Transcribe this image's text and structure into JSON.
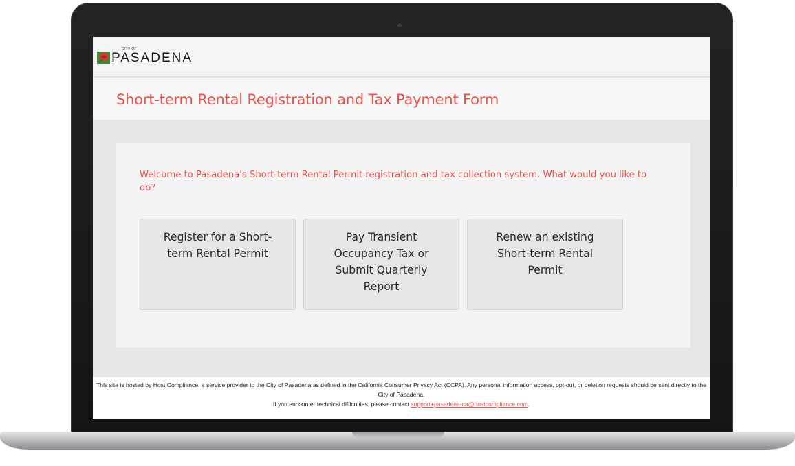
{
  "header": {
    "logo_small": "CITY OF",
    "logo_text": "PASADENA"
  },
  "page": {
    "title": "Short-term Rental Registration and Tax Payment Form",
    "welcome": "Welcome to Pasadena's Short-term Rental Permit registration and tax collection system. What would you like to do?"
  },
  "options": [
    {
      "label": "Register for a Short-term Rental Permit"
    },
    {
      "label": "Pay Transient Occupancy Tax or Submit Quarterly Report"
    },
    {
      "label": "Renew an existing Short-term Rental Permit"
    }
  ],
  "footer": {
    "line1": "This site is hosted by Host Compliance, a service provider to the City of Pasadena as defined in the California Consumer Privacy Act (CCPA). Any personal information access, opt-out, or deletion requests should be sent directly to the City of Pasadena.",
    "line2_prefix": "If you encounter technical difficulties, please contact ",
    "support_email": "support+pasadena-ca@hostcompliance.com",
    "line2_suffix": "."
  },
  "colors": {
    "accent": "#e8534e",
    "logo_red": "#d23b2f",
    "logo_green": "#3f8a3a"
  }
}
